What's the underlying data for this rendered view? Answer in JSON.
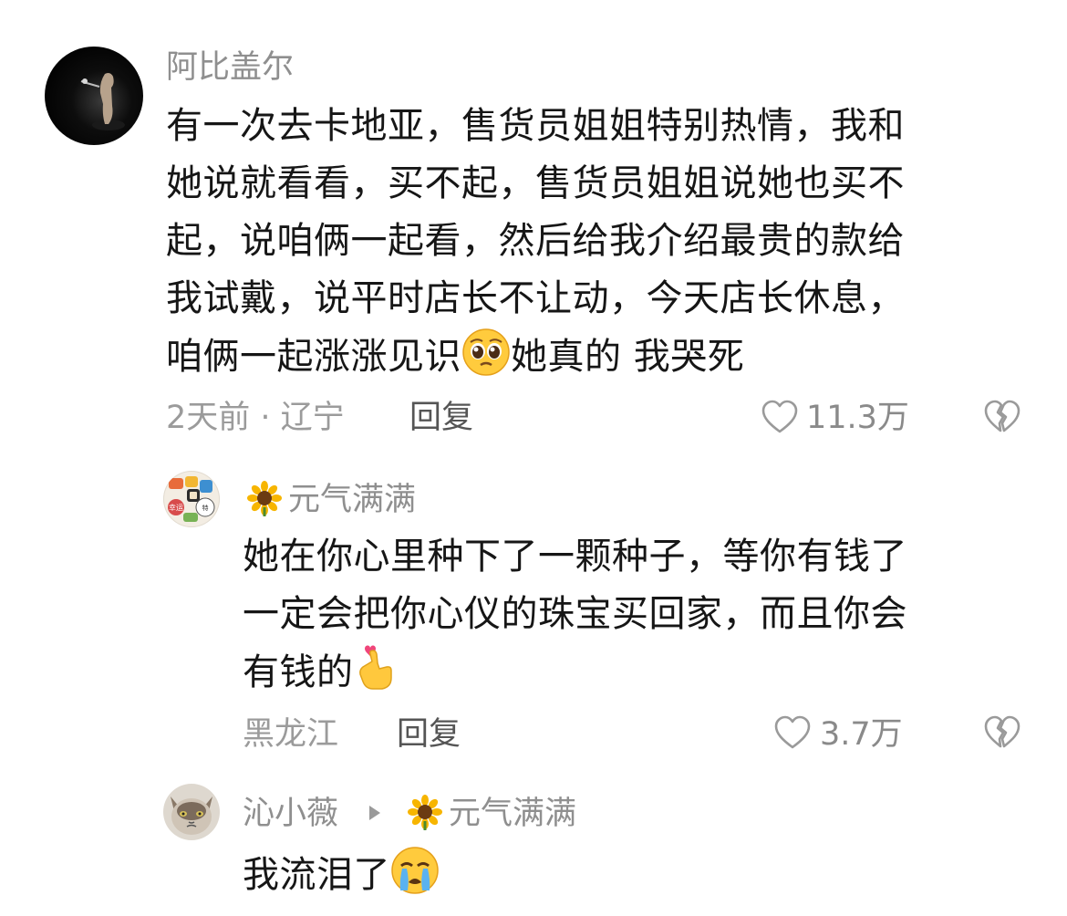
{
  "colors": {
    "text_primary": "#161616",
    "text_secondary": "#8f8f8f",
    "reply": "#555555",
    "icon": "#9a9a9a"
  },
  "comment": {
    "author": "阿比盖尔",
    "avatar": "avatar-dark-figure",
    "text_lines": [
      "有一次去卡地亚，售货员姐姐特别热情，我和",
      "她说就看看，买不起，售货员姐姐说她也买不",
      "起，说咱俩一起看，然后给我介绍最贵的款给",
      "我试戴，说平时店长不让动，今天店长休息，",
      "咱俩一起涨涨见识"
    ],
    "text_tail": "她真的 我哭死",
    "emoji": "pleading-face-emoji",
    "time_location": "2天前 · 辽宁",
    "reply_label": "回复",
    "likes": "11.3万"
  },
  "replies": [
    {
      "author": "元气满满",
      "author_badge": "sunflower-emoji",
      "avatar": "avatar-sticker-collage",
      "text_lines": [
        "她在你心里种下了一颗种子，等你有钱了",
        "一定会把你心仪的珠宝买回家，而且你会",
        "有钱的"
      ],
      "emoji": "heart-hand-emoji",
      "location": "黑龙江",
      "reply_label": "回复",
      "likes": "3.7万"
    },
    {
      "author": "沁小薇",
      "reply_to": "元气满满",
      "reply_to_badge": "sunflower-emoji",
      "avatar": "avatar-cat",
      "text": "我流泪了",
      "emoji": "crying-face-emoji"
    }
  ]
}
